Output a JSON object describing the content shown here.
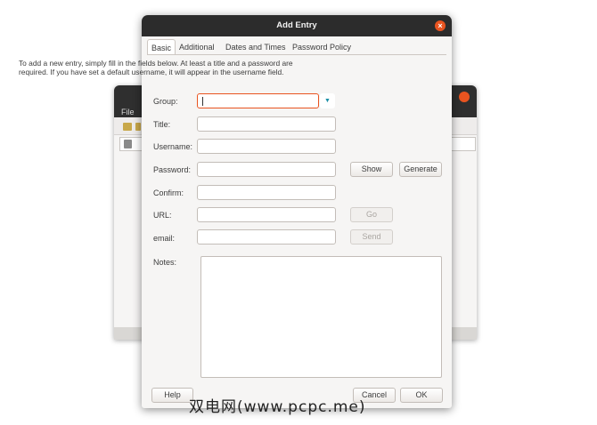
{
  "background_window": {
    "menu_file": "File"
  },
  "dialog": {
    "title": "Add Entry",
    "close_symbol": "×",
    "tabs": [
      {
        "label": "Basic",
        "active": true
      },
      {
        "label": "Additional",
        "active": false
      },
      {
        "label": "Dates and Times",
        "active": false
      },
      {
        "label": "Password Policy",
        "active": false
      }
    ],
    "intro_text": "To add a new entry, simply fill in the fields below. At least a title and a password are required. If you have set a default username, it will appear in the username field.",
    "fields": {
      "group_label": "Group:",
      "group_value": "",
      "group_arrow": "▼",
      "title_label": "Title:",
      "title_value": "",
      "username_label": "Username:",
      "username_value": "",
      "password_label": "Password:",
      "password_value": "",
      "confirm_label": "Confirm:",
      "confirm_value": "",
      "url_label": "URL:",
      "url_value": "",
      "email_label": "email:",
      "email_value": "",
      "notes_label": "Notes:",
      "notes_value": ""
    },
    "buttons": {
      "show": "Show",
      "generate": "Generate",
      "go": "Go",
      "send": "Send",
      "help": "Help",
      "cancel": "Cancel",
      "ok": "OK"
    }
  },
  "watermark": "双电网(www.pcpc.me)",
  "colors": {
    "accent": "#e95420",
    "titlebar": "#2c2c2c",
    "dialog_bg": "#f6f5f4"
  }
}
